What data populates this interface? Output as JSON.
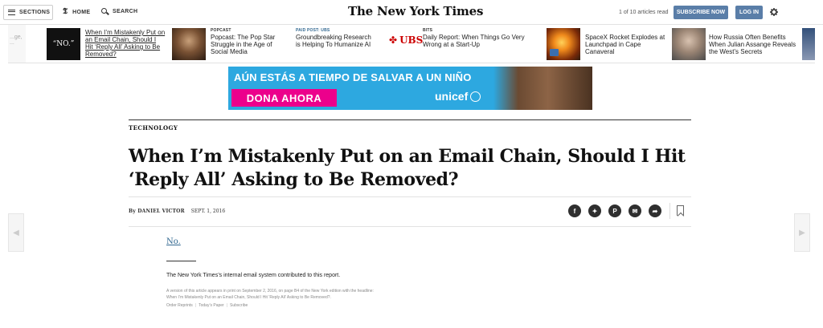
{
  "topbar": {
    "sections_label": "SECTIONS",
    "home_label": "HOME",
    "search_label": "SEARCH",
    "logo": "The New York Times",
    "articles_read": "1 of 10 articles read",
    "subscribe_label": "SUBSCRIBE NOW",
    "login_label": "LOG IN"
  },
  "ribbon": {
    "left_edge_text": "...ge, ...",
    "items": [
      {
        "kicker": "",
        "thumb_text": "“NO.”",
        "text": "When I’m Mistakenly Put on an Email Chain, Should I Hit ‘Reply All’ Asking to Be Removed?"
      },
      {
        "kicker": "POPCAST",
        "text": "Popcast: The Pop Star Struggle in the Age of Social Media"
      },
      {
        "kicker": "PAID POST: UBS",
        "text": "Groundbreaking Research is Helping To Humanize AI",
        "brand": "UBS"
      },
      {
        "kicker": "BITS",
        "text": "Daily Report: When Things Go Very Wrong at a Start-Up"
      },
      {
        "kicker": "",
        "text": "SpaceX Rocket Explodes at Launchpad in Cape Canaveral"
      },
      {
        "kicker": "",
        "text": "How Russia Often Benefits When Julian Assange Reveals the West’s Secrets"
      }
    ]
  },
  "ad": {
    "headline": "AÚN ESTÁS A TIEMPO DE SALVAR A UN NIÑO",
    "donate": "DONA AHORA",
    "brand": "unicef"
  },
  "article": {
    "section": "TECHNOLOGY",
    "headline": "When I’m Mistakenly Put on an Email Chain, Should I Hit ‘Reply All’ Asking to Be Removed?",
    "byline": "By DANIEL VICTOR",
    "date": "SEPT. 1, 2016",
    "body": "No.",
    "contribution": "The New York Times’s internal email system contributed to this report.",
    "print_note_line1": "A version of this article appears in print on September 2, 2016, on page B4 of the New York edition with the headline:",
    "print_note_line2": "When I’m Mistakenly Put on an Email Chain, Should I Hit ‘Reply All’ Asking to Be Removed?.",
    "footer_links": [
      "Order Reprints",
      "Today’s Paper",
      "Subscribe"
    ]
  },
  "share_icons": [
    "facebook-icon",
    "twitter-icon",
    "pinterest-icon",
    "email-icon",
    "share-icon"
  ],
  "colors": {
    "button_blue": "#5a7ea8",
    "link_blue": "#326891",
    "ad_blue": "#2da8e0",
    "ad_pink": "#ec008c",
    "ubs_red": "#cc0000"
  }
}
